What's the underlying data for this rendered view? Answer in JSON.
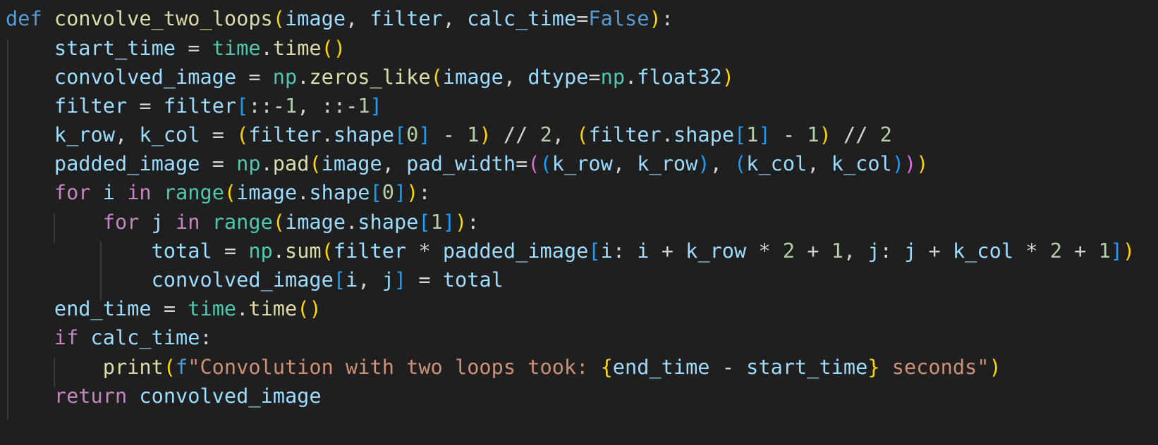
{
  "code_editor": {
    "lines": [
      [
        {
          "text": "def",
          "kind": "keyword"
        },
        {
          "text": " ",
          "kind": "plain"
        },
        {
          "text": "convolve_two_loops",
          "kind": "function"
        },
        {
          "text": "(",
          "kind": "bracket-1"
        },
        {
          "text": "image",
          "kind": "variable"
        },
        {
          "text": ", ",
          "kind": "plain"
        },
        {
          "text": "filter",
          "kind": "variable"
        },
        {
          "text": ", ",
          "kind": "plain"
        },
        {
          "text": "calc_time",
          "kind": "variable"
        },
        {
          "text": "=",
          "kind": "operator"
        },
        {
          "text": "False",
          "kind": "keyword"
        },
        {
          "text": ")",
          "kind": "bracket-1"
        },
        {
          "text": ":",
          "kind": "plain"
        }
      ],
      [
        {
          "text": "    ",
          "kind": "plain"
        },
        {
          "text": "start_time",
          "kind": "variable"
        },
        {
          "text": " = ",
          "kind": "operator"
        },
        {
          "text": "time",
          "kind": "module"
        },
        {
          "text": ".",
          "kind": "plain"
        },
        {
          "text": "time",
          "kind": "function"
        },
        {
          "text": "()",
          "kind": "bracket-1"
        }
      ],
      [
        {
          "text": "    ",
          "kind": "plain"
        },
        {
          "text": "convolved_image",
          "kind": "variable"
        },
        {
          "text": " = ",
          "kind": "operator"
        },
        {
          "text": "np",
          "kind": "module"
        },
        {
          "text": ".",
          "kind": "plain"
        },
        {
          "text": "zeros_like",
          "kind": "function"
        },
        {
          "text": "(",
          "kind": "bracket-1"
        },
        {
          "text": "image",
          "kind": "variable"
        },
        {
          "text": ", ",
          "kind": "plain"
        },
        {
          "text": "dtype",
          "kind": "variable"
        },
        {
          "text": "=",
          "kind": "operator"
        },
        {
          "text": "np",
          "kind": "module"
        },
        {
          "text": ".",
          "kind": "plain"
        },
        {
          "text": "float32",
          "kind": "variable"
        },
        {
          "text": ")",
          "kind": "bracket-1"
        }
      ],
      [
        {
          "text": "    ",
          "kind": "plain"
        },
        {
          "text": "filter",
          "kind": "variable"
        },
        {
          "text": " = ",
          "kind": "operator"
        },
        {
          "text": "filter",
          "kind": "variable"
        },
        {
          "text": "[",
          "kind": "bracket-3"
        },
        {
          "text": "::",
          "kind": "plain"
        },
        {
          "text": "-",
          "kind": "operator"
        },
        {
          "text": "1",
          "kind": "number"
        },
        {
          "text": ", ",
          "kind": "plain"
        },
        {
          "text": "::",
          "kind": "plain"
        },
        {
          "text": "-",
          "kind": "operator"
        },
        {
          "text": "1",
          "kind": "number"
        },
        {
          "text": "]",
          "kind": "bracket-3"
        }
      ],
      [
        {
          "text": "    ",
          "kind": "plain"
        },
        {
          "text": "k_row",
          "kind": "variable"
        },
        {
          "text": ", ",
          "kind": "plain"
        },
        {
          "text": "k_col",
          "kind": "variable"
        },
        {
          "text": " = ",
          "kind": "operator"
        },
        {
          "text": "(",
          "kind": "bracket-1"
        },
        {
          "text": "filter",
          "kind": "variable"
        },
        {
          "text": ".",
          "kind": "plain"
        },
        {
          "text": "shape",
          "kind": "variable"
        },
        {
          "text": "[",
          "kind": "bracket-3"
        },
        {
          "text": "0",
          "kind": "number"
        },
        {
          "text": "]",
          "kind": "bracket-3"
        },
        {
          "text": " - ",
          "kind": "operator"
        },
        {
          "text": "1",
          "kind": "number"
        },
        {
          "text": ")",
          "kind": "bracket-1"
        },
        {
          "text": " // ",
          "kind": "operator"
        },
        {
          "text": "2",
          "kind": "number"
        },
        {
          "text": ", ",
          "kind": "plain"
        },
        {
          "text": "(",
          "kind": "bracket-1"
        },
        {
          "text": "filter",
          "kind": "variable"
        },
        {
          "text": ".",
          "kind": "plain"
        },
        {
          "text": "shape",
          "kind": "variable"
        },
        {
          "text": "[",
          "kind": "bracket-3"
        },
        {
          "text": "1",
          "kind": "number"
        },
        {
          "text": "]",
          "kind": "bracket-3"
        },
        {
          "text": " - ",
          "kind": "operator"
        },
        {
          "text": "1",
          "kind": "number"
        },
        {
          "text": ")",
          "kind": "bracket-1"
        },
        {
          "text": " // ",
          "kind": "operator"
        },
        {
          "text": "2",
          "kind": "number"
        }
      ],
      [
        {
          "text": "    ",
          "kind": "plain"
        },
        {
          "text": "padded_image",
          "kind": "variable"
        },
        {
          "text": " = ",
          "kind": "operator"
        },
        {
          "text": "np",
          "kind": "module"
        },
        {
          "text": ".",
          "kind": "plain"
        },
        {
          "text": "pad",
          "kind": "function"
        },
        {
          "text": "(",
          "kind": "bracket-1"
        },
        {
          "text": "image",
          "kind": "variable"
        },
        {
          "text": ", ",
          "kind": "plain"
        },
        {
          "text": "pad_width",
          "kind": "variable"
        },
        {
          "text": "=",
          "kind": "operator"
        },
        {
          "text": "(",
          "kind": "bracket-2"
        },
        {
          "text": "(",
          "kind": "bracket-3"
        },
        {
          "text": "k_row",
          "kind": "variable"
        },
        {
          "text": ", ",
          "kind": "plain"
        },
        {
          "text": "k_row",
          "kind": "variable"
        },
        {
          "text": ")",
          "kind": "bracket-3"
        },
        {
          "text": ", ",
          "kind": "plain"
        },
        {
          "text": "(",
          "kind": "bracket-3"
        },
        {
          "text": "k_col",
          "kind": "variable"
        },
        {
          "text": ", ",
          "kind": "plain"
        },
        {
          "text": "k_col",
          "kind": "variable"
        },
        {
          "text": ")",
          "kind": "bracket-3"
        },
        {
          "text": ")",
          "kind": "bracket-2"
        },
        {
          "text": ")",
          "kind": "bracket-1"
        }
      ],
      [
        {
          "text": "    ",
          "kind": "plain"
        },
        {
          "text": "for",
          "kind": "control"
        },
        {
          "text": " ",
          "kind": "plain"
        },
        {
          "text": "i",
          "kind": "variable"
        },
        {
          "text": " ",
          "kind": "plain"
        },
        {
          "text": "in",
          "kind": "control"
        },
        {
          "text": " ",
          "kind": "plain"
        },
        {
          "text": "range",
          "kind": "module"
        },
        {
          "text": "(",
          "kind": "bracket-1"
        },
        {
          "text": "image",
          "kind": "variable"
        },
        {
          "text": ".",
          "kind": "plain"
        },
        {
          "text": "shape",
          "kind": "variable"
        },
        {
          "text": "[",
          "kind": "bracket-3"
        },
        {
          "text": "0",
          "kind": "number"
        },
        {
          "text": "]",
          "kind": "bracket-3"
        },
        {
          "text": ")",
          "kind": "bracket-1"
        },
        {
          "text": ":",
          "kind": "plain"
        }
      ],
      [
        {
          "text": "        ",
          "kind": "plain"
        },
        {
          "text": "for",
          "kind": "control"
        },
        {
          "text": " ",
          "kind": "plain"
        },
        {
          "text": "j",
          "kind": "variable"
        },
        {
          "text": " ",
          "kind": "plain"
        },
        {
          "text": "in",
          "kind": "control"
        },
        {
          "text": " ",
          "kind": "plain"
        },
        {
          "text": "range",
          "kind": "module"
        },
        {
          "text": "(",
          "kind": "bracket-1"
        },
        {
          "text": "image",
          "kind": "variable"
        },
        {
          "text": ".",
          "kind": "plain"
        },
        {
          "text": "shape",
          "kind": "variable"
        },
        {
          "text": "[",
          "kind": "bracket-3"
        },
        {
          "text": "1",
          "kind": "number"
        },
        {
          "text": "]",
          "kind": "bracket-3"
        },
        {
          "text": ")",
          "kind": "bracket-1"
        },
        {
          "text": ":",
          "kind": "plain"
        }
      ],
      [
        {
          "text": "            ",
          "kind": "plain"
        },
        {
          "text": "total",
          "kind": "variable"
        },
        {
          "text": " = ",
          "kind": "operator"
        },
        {
          "text": "np",
          "kind": "module"
        },
        {
          "text": ".",
          "kind": "plain"
        },
        {
          "text": "sum",
          "kind": "function"
        },
        {
          "text": "(",
          "kind": "bracket-1"
        },
        {
          "text": "filter",
          "kind": "variable"
        },
        {
          "text": " * ",
          "kind": "operator"
        },
        {
          "text": "padded_image",
          "kind": "variable"
        },
        {
          "text": "[",
          "kind": "bracket-3"
        },
        {
          "text": "i",
          "kind": "variable"
        },
        {
          "text": ": ",
          "kind": "plain"
        },
        {
          "text": "i",
          "kind": "variable"
        },
        {
          "text": " + ",
          "kind": "operator"
        },
        {
          "text": "k_row",
          "kind": "variable"
        },
        {
          "text": " * ",
          "kind": "operator"
        },
        {
          "text": "2",
          "kind": "number"
        },
        {
          "text": " + ",
          "kind": "operator"
        },
        {
          "text": "1",
          "kind": "number"
        },
        {
          "text": ", ",
          "kind": "plain"
        },
        {
          "text": "j",
          "kind": "variable"
        },
        {
          "text": ": ",
          "kind": "plain"
        },
        {
          "text": "j",
          "kind": "variable"
        },
        {
          "text": " + ",
          "kind": "operator"
        },
        {
          "text": "k_col",
          "kind": "variable"
        },
        {
          "text": " * ",
          "kind": "operator"
        },
        {
          "text": "2",
          "kind": "number"
        },
        {
          "text": " + ",
          "kind": "operator"
        },
        {
          "text": "1",
          "kind": "number"
        },
        {
          "text": "]",
          "kind": "bracket-3"
        },
        {
          "text": ")",
          "kind": "bracket-1"
        }
      ],
      [
        {
          "text": "            ",
          "kind": "plain"
        },
        {
          "text": "convolved_image",
          "kind": "variable"
        },
        {
          "text": "[",
          "kind": "bracket-3"
        },
        {
          "text": "i",
          "kind": "variable"
        },
        {
          "text": ", ",
          "kind": "plain"
        },
        {
          "text": "j",
          "kind": "variable"
        },
        {
          "text": "]",
          "kind": "bracket-3"
        },
        {
          "text": " = ",
          "kind": "operator"
        },
        {
          "text": "total",
          "kind": "variable"
        }
      ],
      [
        {
          "text": "    ",
          "kind": "plain"
        },
        {
          "text": "end_time",
          "kind": "variable"
        },
        {
          "text": " = ",
          "kind": "operator"
        },
        {
          "text": "time",
          "kind": "module"
        },
        {
          "text": ".",
          "kind": "plain"
        },
        {
          "text": "time",
          "kind": "function"
        },
        {
          "text": "()",
          "kind": "bracket-1"
        }
      ],
      [
        {
          "text": "    ",
          "kind": "plain"
        },
        {
          "text": "if",
          "kind": "control"
        },
        {
          "text": " ",
          "kind": "plain"
        },
        {
          "text": "calc_time",
          "kind": "variable"
        },
        {
          "text": ":",
          "kind": "plain"
        }
      ],
      [
        {
          "text": "        ",
          "kind": "plain"
        },
        {
          "text": "print",
          "kind": "function"
        },
        {
          "text": "(",
          "kind": "bracket-1"
        },
        {
          "text": "f",
          "kind": "fprefix"
        },
        {
          "text": "\"Convolution with two loops took: ",
          "kind": "string"
        },
        {
          "text": "{",
          "kind": "bracket-1"
        },
        {
          "text": "end_time",
          "kind": "variable"
        },
        {
          "text": " - ",
          "kind": "operator"
        },
        {
          "text": "start_time",
          "kind": "variable"
        },
        {
          "text": "}",
          "kind": "bracket-1"
        },
        {
          "text": " seconds\"",
          "kind": "string"
        },
        {
          "text": ")",
          "kind": "bracket-1"
        }
      ],
      [
        {
          "text": "    ",
          "kind": "plain"
        },
        {
          "text": "return",
          "kind": "control"
        },
        {
          "text": " ",
          "kind": "plain"
        },
        {
          "text": "convolved_image",
          "kind": "variable"
        }
      ]
    ]
  }
}
